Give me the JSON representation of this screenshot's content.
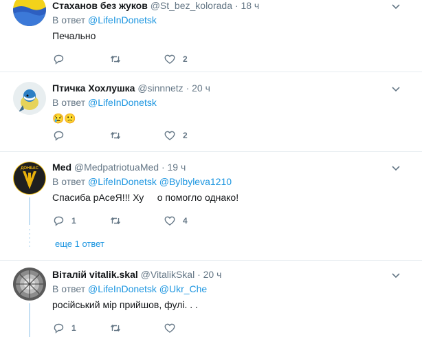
{
  "tweets": [
    {
      "name": "Стаханов без жуков",
      "handle": "@St_bez_kolorada",
      "time": "18 ч",
      "reply_prefix": "В ответ",
      "mentions": [
        "@LifeInDonetsk"
      ],
      "text": "Печально",
      "replies": "",
      "retweets": "",
      "likes": "2"
    },
    {
      "name": "Птичка Хохлушка",
      "handle": "@sinnnetz",
      "time": "20 ч",
      "reply_prefix": "В ответ",
      "mentions": [
        "@LifeInDonetsk"
      ],
      "text": "😢🙁",
      "replies": "",
      "retweets": "",
      "likes": "2"
    },
    {
      "name": "Med",
      "handle": "@MedpatriotuaMed",
      "time": "19 ч",
      "reply_prefix": "В ответ",
      "mentions": [
        "@LifeInDonetsk",
        "@Bylbyleva1210"
      ],
      "text": "Спасиба рАсеЯ!!! Ху     о помогло однако!",
      "avatar_text": "ДОНБАС",
      "replies": "1",
      "retweets": "",
      "likes": "4",
      "more_replies": "еще 1 ответ"
    },
    {
      "name": "Віталій vitalik.skal",
      "handle": "@VitalikSkal",
      "time": "20 ч",
      "reply_prefix": "В ответ",
      "mentions": [
        "@LifeInDonetsk",
        "@Ukr_Che"
      ],
      "text": "російський мір прийшов, фулі. . .",
      "replies": "1",
      "retweets": "",
      "likes": ""
    }
  ],
  "colors": {
    "link": "#1b95e0",
    "muted": "#657786",
    "thread": "#c4dff3",
    "divider": "#e6ecf0"
  },
  "icons": [
    "reply-icon",
    "retweet-icon",
    "like-icon",
    "chevron-down-icon"
  ]
}
